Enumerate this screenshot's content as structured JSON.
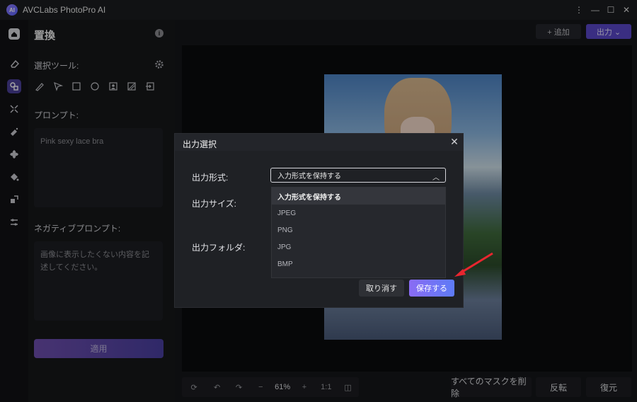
{
  "app": {
    "title": "AVCLabs PhotoPro AI",
    "logo_text": "AI"
  },
  "window_controls": {
    "menu": "⋮",
    "minimize": "—",
    "maximize": "☐",
    "close": "✕"
  },
  "panel": {
    "title": "置換",
    "info": "i",
    "selection_tool_label": "選択ツール:",
    "prompt_label": "プロンプト:",
    "prompt_value": "Pink sexy lace bra",
    "negative_prompt_label": "ネガティブプロンプト:",
    "negative_prompt_placeholder": "画像に表示したくない内容を記述してください。",
    "apply_label": "適用"
  },
  "toolbar": {
    "add_label": "+ 追加",
    "output_label": "出力 ⌄"
  },
  "bottom": {
    "zoom": "61%",
    "ratio": "1:1",
    "clear_masks": "すべてのマスクを削除",
    "invert": "反転",
    "restore": "復元"
  },
  "dialog": {
    "title": "出力選択",
    "format_label": "出力形式:",
    "size_label": "出力サイズ:",
    "folder_label": "出力フォルダ:",
    "selected_format": "入力形式を保持する",
    "options": [
      "入力形式を保持する",
      "JPEG",
      "PNG",
      "JPG",
      "BMP"
    ],
    "cancel_label": "取り消す",
    "save_label": "保存する"
  },
  "colors": {
    "accent": "#6e5cf0",
    "arrow": "#e8262f"
  }
}
